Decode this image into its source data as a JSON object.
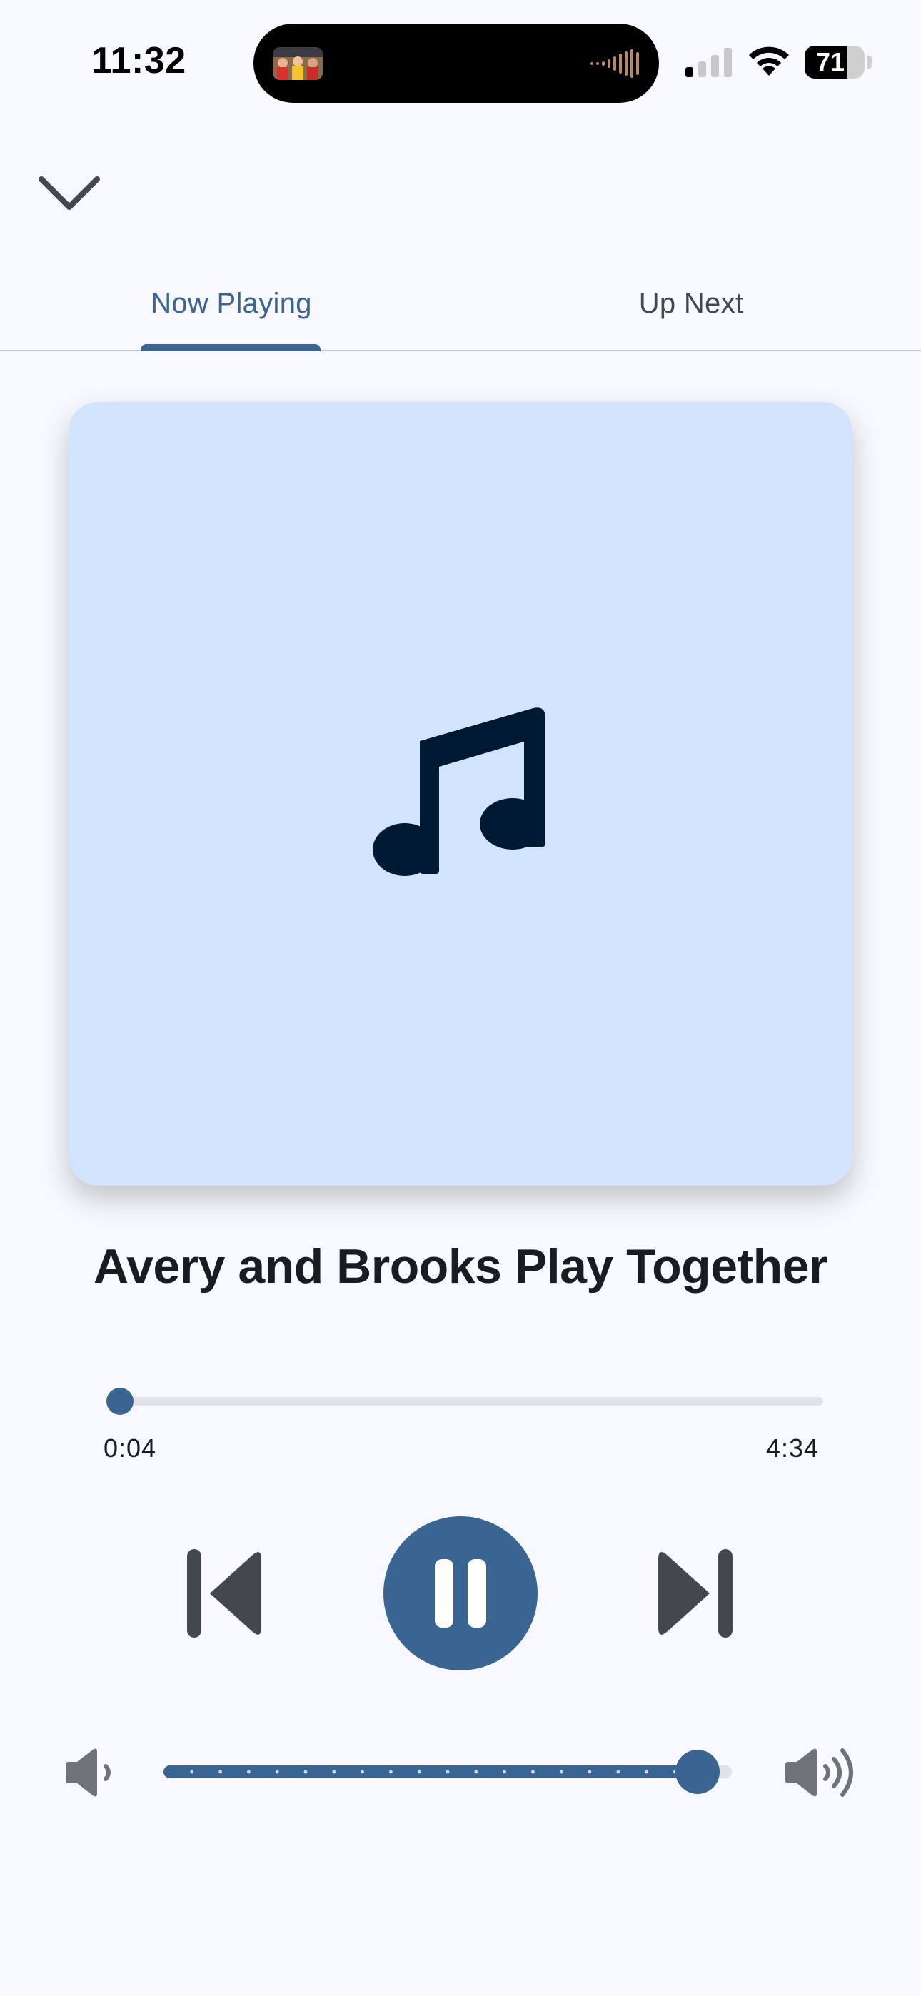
{
  "status_bar": {
    "time": "11:32",
    "battery_level": 71,
    "battery_text": "71",
    "signal_bars_active": 1,
    "icons": [
      "signal-icon",
      "wifi-icon",
      "battery-icon"
    ]
  },
  "header": {
    "collapse_icon": "chevron-down-icon"
  },
  "tabs": [
    {
      "label": "Now Playing",
      "selected": true
    },
    {
      "label": "Up Next",
      "selected": false
    }
  ],
  "artwork": {
    "icon": "music-note-icon",
    "background_color": "#d2e3fd"
  },
  "track": {
    "title": "Avery and Brooks Play Together"
  },
  "progress": {
    "elapsed": "0:04",
    "total": "4:34",
    "fraction": 0.0146
  },
  "controls": {
    "prev_icon": "skip-previous-icon",
    "play_pause_icon": "pause-icon",
    "next_icon": "skip-next-icon",
    "state": "playing"
  },
  "volume": {
    "level": 0.94,
    "low_icon": "volume-low-icon",
    "high_icon": "volume-high-icon"
  },
  "colors": {
    "accent": "#3a6592",
    "background": "#f7f9fe",
    "artwork_note": "#001a33"
  }
}
